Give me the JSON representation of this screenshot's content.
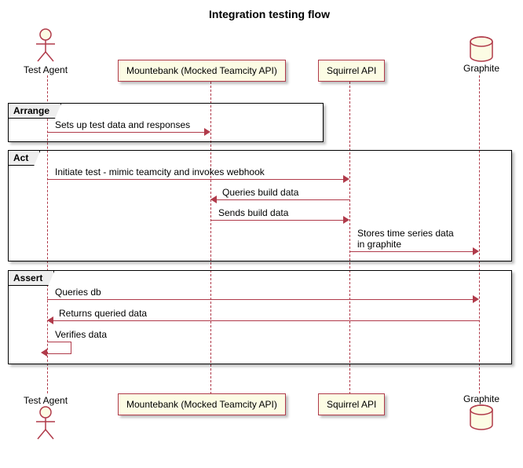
{
  "title": "Integration testing flow",
  "participants": {
    "testAgent": "Test Agent",
    "mountebank": "Mountebank (Mocked Teamcity API)",
    "squirrel": "Squirrel API",
    "graphite": "Graphite"
  },
  "groups": {
    "arrange": "Arrange",
    "act": "Act",
    "assert": "Assert"
  },
  "messages": {
    "setup": "Sets up test data and responses",
    "initiate": "Initiate test - mimic teamcity and invokes webhook",
    "queriesBuild": "Queries  build data",
    "sendsBuild": "Sends build data",
    "storesTs1": "Stores time series data",
    "storesTs2": "in graphite",
    "queriesDb": "Queries db",
    "returnsData": "Returns queried data",
    "verifies": "Verifies data"
  }
}
